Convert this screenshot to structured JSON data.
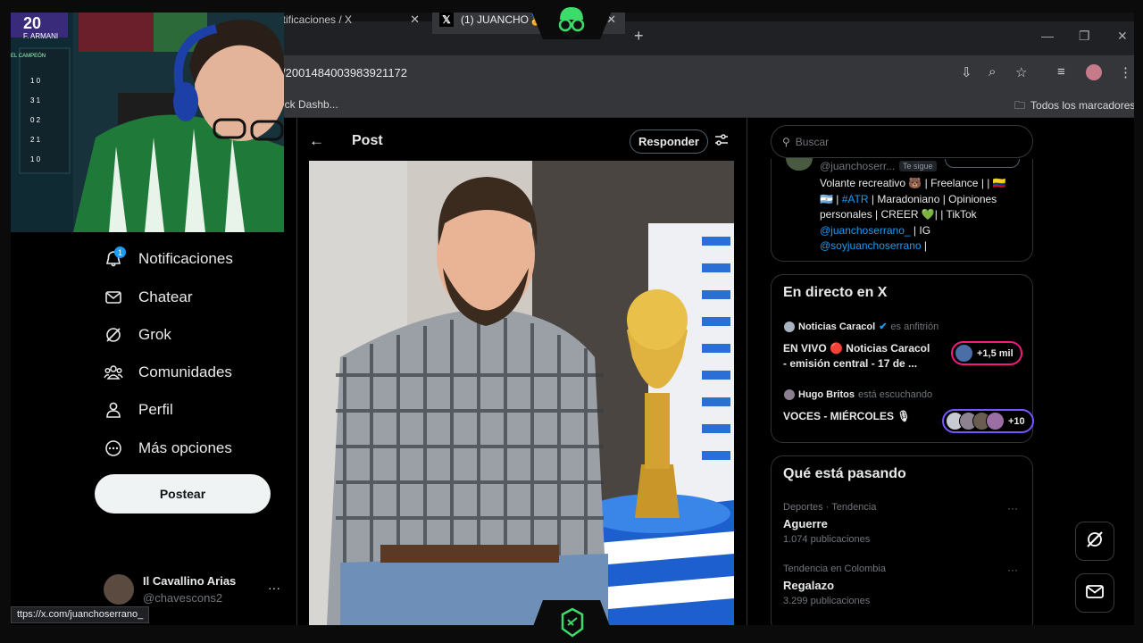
{
  "browser": {
    "tabs": [
      {
        "title": "otificaciones / X"
      },
      {
        "title": "(1) JUANCHO🏅 ·"
      }
    ],
    "new_tab": "+",
    "url": "/2001484003983921172",
    "bookmark_left": "ick Dashb...",
    "bookmark_right": "Todos los marcadores",
    "status_url": "ttps://x.com/juanchoserrano_"
  },
  "nav": {
    "items": [
      {
        "label": "Notificaciones",
        "icon": "bell-icon"
      },
      {
        "label": "Chatear",
        "icon": "envelope-icon"
      },
      {
        "label": "Grok",
        "icon": "grok-icon"
      },
      {
        "label": "Comunidades",
        "icon": "people-icon"
      },
      {
        "label": "Perfil",
        "icon": "person-icon"
      },
      {
        "label": "Más opciones",
        "icon": "more-circle-icon"
      }
    ],
    "notif_badge": "1",
    "post_button": "Postear"
  },
  "account": {
    "name": "Il Cavallino Arias",
    "handle": "@chavescons2",
    "more": "···"
  },
  "post_header": {
    "back": "←",
    "title": "Post",
    "reply": "Responder"
  },
  "search": {
    "placeholder": "Buscar"
  },
  "profile_card": {
    "handle": "@juanchoserr...",
    "follows_you": "Te sigue",
    "bio_1": "Volante recreativo 🐻 | Freelance | | 🇨🇴",
    "bio_2a": "🇦🇷 | ",
    "bio_2_hashtag": "#ATR",
    "bio_2b": " | Maradoniano | Opiniones",
    "bio_3": "personales | CREER 💚| | TikTok",
    "bio_4_link": "@juanchoserrano_",
    "bio_4b": " | IG",
    "bio_5_link": "@soyjuanchoserrano",
    "bio_5b": " |"
  },
  "live": {
    "title": "En directo en X",
    "spaces": [
      {
        "host": "Noticias Caracol",
        "role": "es anfitrión",
        "title_1": "EN VIVO 🔴 Noticias Caracol",
        "title_2": "- emisión central - 17 de ...",
        "count": "+1,5 mil"
      },
      {
        "host": "Hugo Britos",
        "role": "está escuchando",
        "title_1": "VOCES - MIÉRCOLES 🎙",
        "count": "+10"
      }
    ]
  },
  "trends": {
    "title": "Qué está pasando",
    "items": [
      {
        "meta": "Deportes · Tendencia",
        "name": "Aguerre",
        "count": "1.074 publicaciones"
      },
      {
        "meta": "Tendencia en Colombia",
        "name": "Regalazo",
        "count": "3.299 publicaciones"
      }
    ]
  },
  "webcam": {
    "jersey_name": "F. ARMANI",
    "jersey_number": "20",
    "scoreboard_title": "EL CAMPEÓN",
    "scores": [
      "1 0",
      "3 1",
      "0 2",
      "2 1",
      "1 0"
    ]
  },
  "colors": {
    "accent": "#1d9bf0",
    "live_pink": "#f91880",
    "live_purple": "#7856ff",
    "brand_green": "#3ddc6a"
  }
}
